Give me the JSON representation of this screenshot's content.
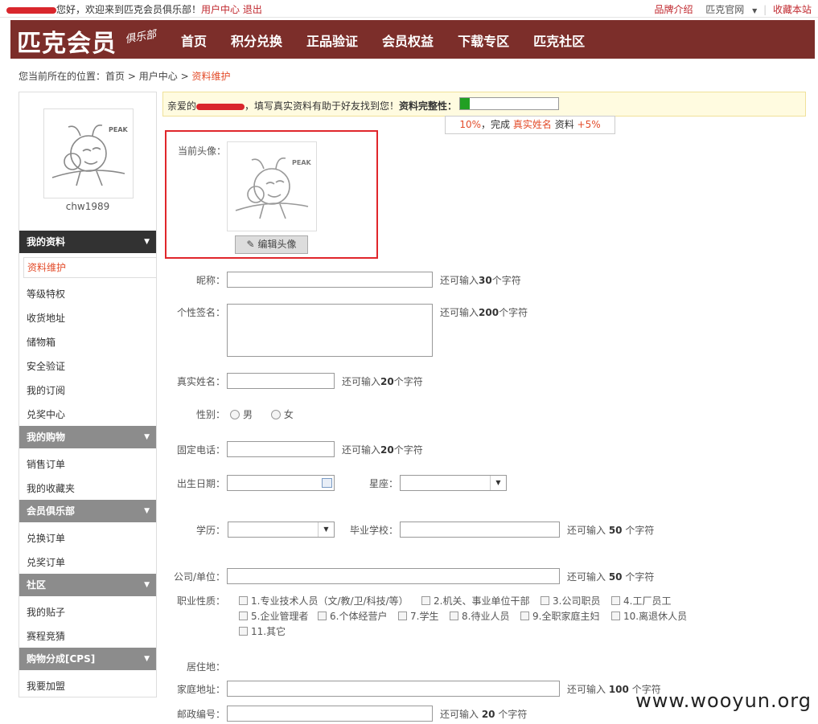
{
  "topbar": {
    "greeting": "您好，欢迎来到匹克会员俱乐部！",
    "user_center": "用户中心",
    "logout": "退出",
    "brand_intro": "品牌介绍",
    "official": "匹克官网",
    "bookmark": "收藏本站"
  },
  "nav": {
    "logo": "匹克会员",
    "logo_club": "俱乐部",
    "items": [
      "首页",
      "积分兑换",
      "正品验证",
      "会员权益",
      "下载专区",
      "匹克社区"
    ]
  },
  "breadcrumb": {
    "prefix": "您当前所在的位置：",
    "home": "首页",
    "user_center": "用户中心",
    "current": "资料维护",
    "sep": ">"
  },
  "sidebar": {
    "username": "chw1989",
    "sections": [
      {
        "title": "我的资料",
        "items": [
          "资料维护",
          "等级特权",
          "收货地址",
          "储物箱",
          "安全验证",
          "我的订阅",
          "兑奖中心"
        ]
      },
      {
        "title": "我的购物",
        "items": [
          "销售订单",
          "我的收藏夹"
        ]
      },
      {
        "title": "会员俱乐部",
        "items": [
          "兑换订单",
          "兑奖订单"
        ]
      },
      {
        "title": "社区",
        "items": [
          "我的贴子",
          "赛程竞猜"
        ]
      },
      {
        "title": "购物分成[CPS]",
        "items": [
          "我要加盟"
        ]
      }
    ]
  },
  "notice": {
    "dear": "亲爱的",
    "text": "，填写真实资料有助于好友找到您！",
    "complete": "资料完整性：",
    "progress": 0.1,
    "tip_pct": "10%",
    "tip_done": "，完成",
    "tip_field": "真实姓名",
    "tip_data": "资料",
    "tip_plus": "+5%"
  },
  "avatar": {
    "label": "当前头像：",
    "edit": "编辑头像",
    "brand": "PEAK"
  },
  "form": {
    "nickname": {
      "label": "昵称：",
      "hint_pre": "还可输入",
      "hint_num": "30",
      "hint_post": "个字符"
    },
    "signature": {
      "label": "个性签名：",
      "hint_pre": "还可输入",
      "hint_num": "200",
      "hint_post": "个字符"
    },
    "realname": {
      "label": "真实姓名：",
      "hint_pre": "还可输入",
      "hint_num": "20",
      "hint_post": "个字符"
    },
    "gender": {
      "label": "性别：",
      "male": "男",
      "female": "女"
    },
    "phone": {
      "label": "固定电话：",
      "hint_pre": "还可输入",
      "hint_num": "20",
      "hint_post": "个字符"
    },
    "birthday": {
      "label": "出生日期："
    },
    "zodiac": {
      "label": "星座："
    },
    "education": {
      "label": "学历："
    },
    "school": {
      "label": "毕业学校：",
      "hint_pre": "还可输入 ",
      "hint_num": "50",
      "hint_post": " 个字符"
    },
    "company": {
      "label": "公司/单位：",
      "hint_pre": "还可输入 ",
      "hint_num": "50",
      "hint_post": " 个字符"
    },
    "occupation": {
      "label": "职业性质：",
      "options": [
        "1.专业技术人员（文/教/卫/科技/等）",
        "2.机关、事业单位干部",
        "3.公司职员",
        "4.工厂员工",
        "5.企业管理者",
        "6.个体经营户",
        "7.学生",
        "8.待业人员",
        "9.全职家庭主妇",
        "10.离退休人员",
        "11.其它"
      ]
    },
    "residence": {
      "label": "居住地："
    },
    "address": {
      "label": "家庭地址：",
      "hint_pre": "还可输入 ",
      "hint_num": "100",
      "hint_post": " 个字符"
    },
    "postcode": {
      "label": "邮政编号：",
      "hint_pre": "还可输入 ",
      "hint_num": "20",
      "hint_post": " 个字符"
    }
  },
  "watermark": "www.wooyun.org",
  "colors": {
    "nav_bg": "#7c2e2a",
    "accent": "#e34c2a",
    "progress": "#21a023",
    "highlight": "#e0262b"
  }
}
